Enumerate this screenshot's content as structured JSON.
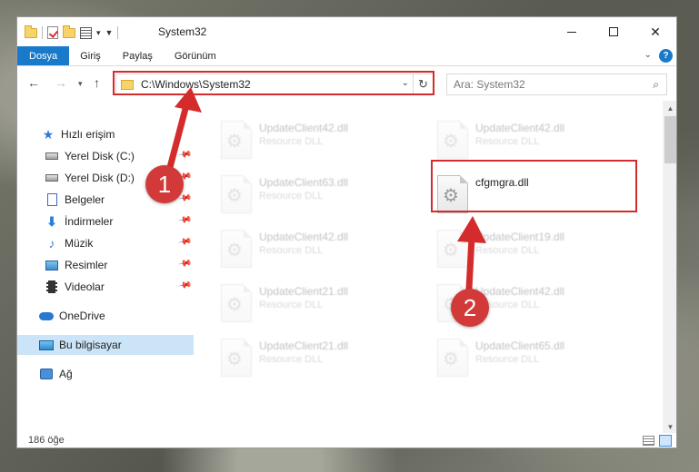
{
  "window": {
    "title": "System32",
    "help_label": "?",
    "controls": {
      "minimize": "minimize",
      "maximize": "maximize",
      "close": "✕"
    }
  },
  "ribbon": {
    "tabs": [
      {
        "label": "Dosya",
        "active": true
      },
      {
        "label": "Giriş",
        "active": false
      },
      {
        "label": "Paylaş",
        "active": false
      },
      {
        "label": "Görünüm",
        "active": false
      }
    ]
  },
  "navigation": {
    "address": "C:\\Windows\\System32",
    "search_placeholder": "Ara: System32"
  },
  "sidebar": {
    "items": [
      {
        "label": "Hızlı erişim",
        "icon": "star-icon"
      },
      {
        "label": "Yerel Disk (C:)",
        "icon": "drive-icon"
      },
      {
        "label": "Yerel Disk (D:)",
        "icon": "drive-icon"
      },
      {
        "label": "Belgeler",
        "icon": "documents-icon"
      },
      {
        "label": "İndirmeler",
        "icon": "downloads-icon"
      },
      {
        "label": "Müzik",
        "icon": "music-icon"
      },
      {
        "label": "Resimler",
        "icon": "pictures-icon"
      },
      {
        "label": "Videolar",
        "icon": "videos-icon"
      },
      {
        "label": "OneDrive",
        "icon": "onedrive-icon"
      },
      {
        "label": "Bu bilgisayar",
        "icon": "computer-icon",
        "selected": true
      },
      {
        "label": "Ağ",
        "icon": "network-icon"
      }
    ]
  },
  "files": [
    {
      "name": "UpdateClient42.dll",
      "type": "Resource DLL",
      "faded": true
    },
    {
      "name": "UpdateClient42.dll",
      "type": "Resource DLL",
      "faded": true
    },
    {
      "name": "UpdateClient63.dll",
      "type": "Resource DLL",
      "faded": true
    },
    {
      "name": "cfgmgra.dll",
      "type": "",
      "faded": false
    },
    {
      "name": "UpdateClient42.dll",
      "type": "Resource DLL",
      "faded": true
    },
    {
      "name": "UpdateClient19.dll",
      "type": "Resource DLL",
      "faded": true
    },
    {
      "name": "UpdateClient21.dll",
      "type": "Resource DLL",
      "faded": true
    },
    {
      "name": "UpdateClient42.dll",
      "type": "Resource DLL",
      "faded": true
    },
    {
      "name": "UpdateClient21.dll",
      "type": "Resource DLL",
      "faded": true
    },
    {
      "name": "UpdateClient65.dll",
      "type": "Resource DLL",
      "faded": true
    }
  ],
  "status": {
    "item_count": "186 öğe"
  },
  "annotations": {
    "step1": "1",
    "step2": "2",
    "color": "#d42c2c"
  },
  "colors": {
    "accent": "#1979ca",
    "selection": "#cce4f7"
  }
}
